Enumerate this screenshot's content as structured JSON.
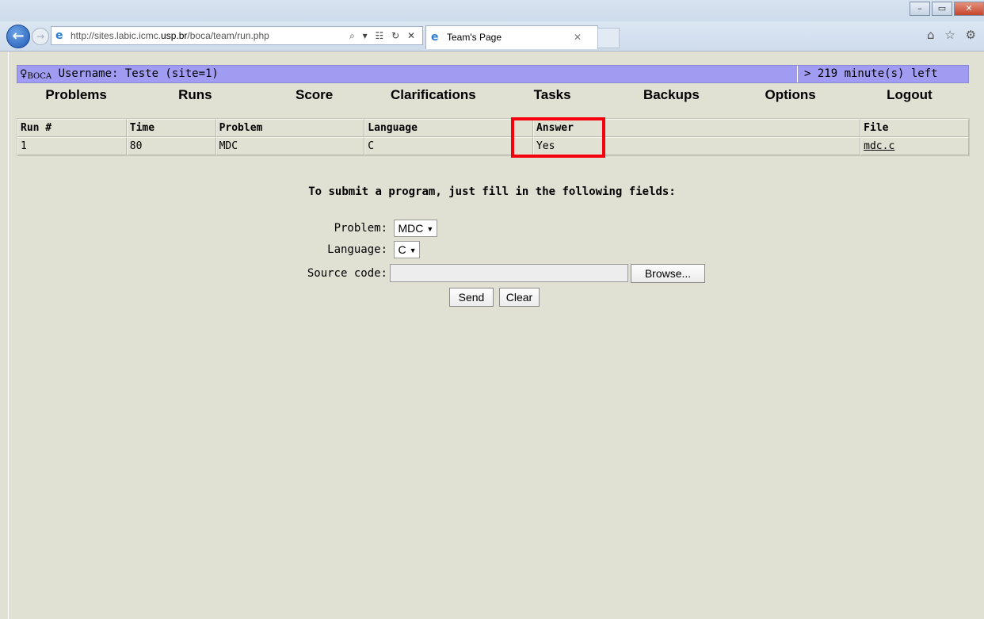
{
  "browser": {
    "address_prefix": "http://sites.labic.icmc.",
    "address_host": "usp.br",
    "address_suffix": "/boca/team/run.php",
    "address_tools": "⌕ ▾ ☷ ↻ ✕",
    "tab_title": "Team's Page",
    "tab_close": "✕",
    "right_icons": "⌂ ☆ ⚙"
  },
  "header": {
    "logo_main": "♀",
    "logo_sub": "BOCA",
    "username_text": "Username: Teste (site=1)",
    "time_left": "> 219 minute(s) left"
  },
  "menu": [
    "Problems",
    "Runs",
    "Score",
    "Clarifications",
    "Tasks",
    "Backups",
    "Options",
    "Logout"
  ],
  "runs_table": {
    "columns": [
      "Run #",
      "Time",
      "Problem",
      "Language",
      "Answer",
      "File"
    ],
    "rows": [
      {
        "run": "1",
        "time": "80",
        "problem": "MDC",
        "language": "C",
        "answer": "Yes",
        "file": "mdc.c"
      }
    ]
  },
  "submit": {
    "instructions": "To submit a program, just fill in the following fields:",
    "problem_label": "Problem:",
    "problem_value": "MDC",
    "language_label": "Language:",
    "language_value": "C",
    "source_label": "Source code:",
    "browse_label": "Browse...",
    "send_label": "Send",
    "clear_label": "Clear"
  }
}
